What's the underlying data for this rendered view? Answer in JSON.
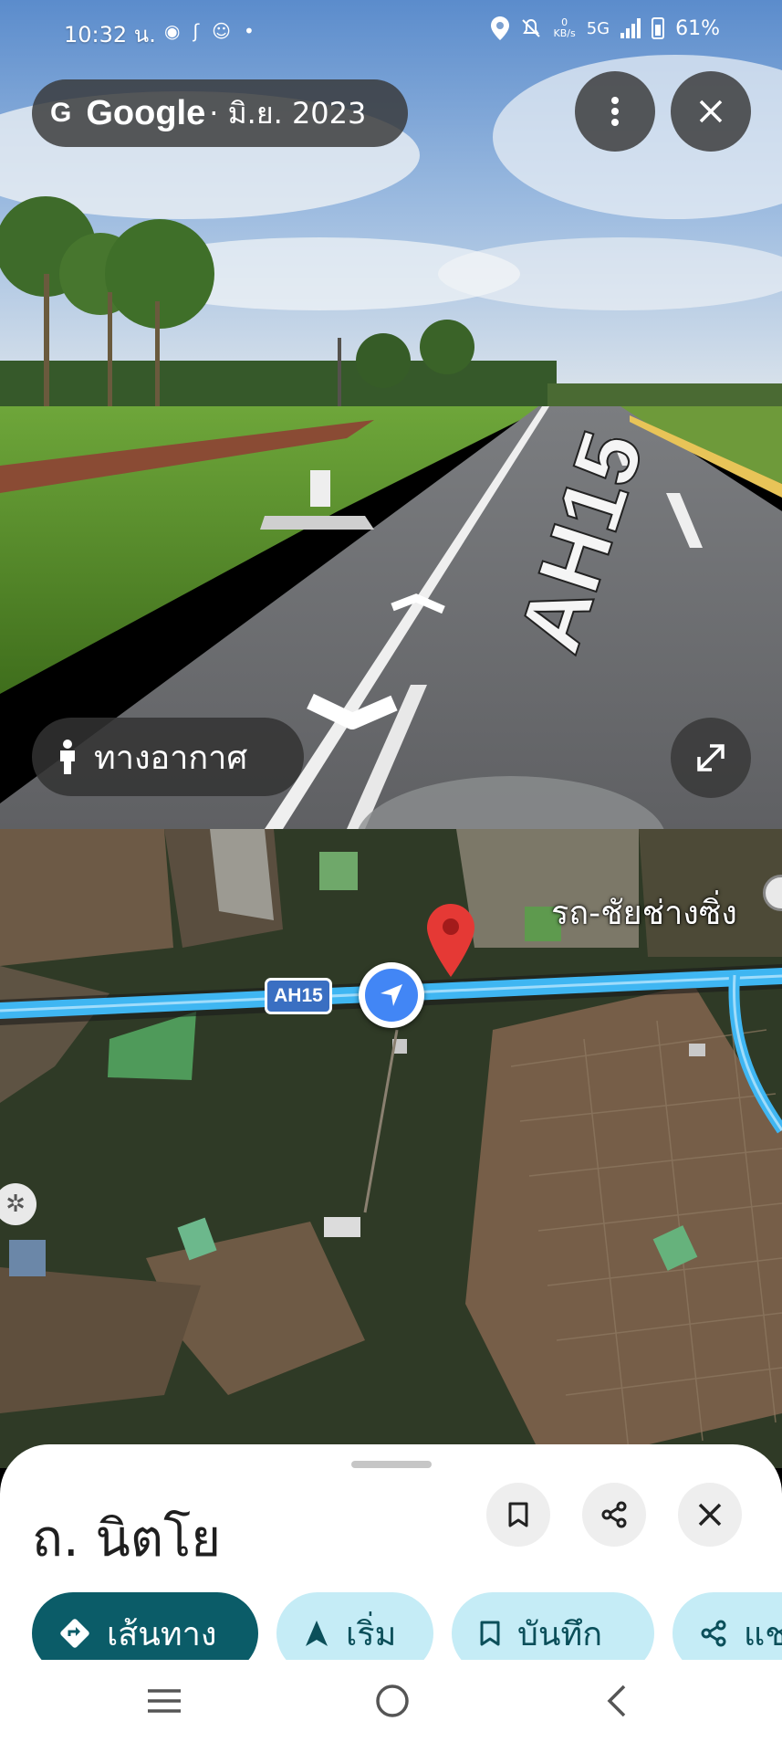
{
  "status_bar": {
    "time": "10:32 น.",
    "net_speed_value": "0",
    "net_speed_unit": "KB/s",
    "network": "5G",
    "battery": "61%",
    "icons": [
      "line-icon",
      "s-app-icon",
      "character-icon",
      "dot-icon",
      "location-icon",
      "mute-icon",
      "signal-icon",
      "battery-icon"
    ]
  },
  "street_view": {
    "brand": "Google",
    "date": "· มิ.ย. 2023",
    "aerial_label": "ทางอากาศ",
    "road_marking": "AH15"
  },
  "map": {
    "road_label": "AH15",
    "place_label": "รถ-ชัยช่างซิ่ง",
    "colors": {
      "route": "#3fb6f2",
      "pin": "#e53935",
      "nav": "#4286f5"
    }
  },
  "sheet": {
    "title": "ถ. นิตโย",
    "actions": [
      {
        "label": "เส้นทาง",
        "icon": "directions-icon"
      },
      {
        "label": "เริ่ม",
        "icon": "navigation-arrow-icon"
      },
      {
        "label": "บันทึก",
        "icon": "bookmark-icon"
      },
      {
        "label": "แช",
        "icon": "share-icon"
      }
    ]
  },
  "colors": {
    "primary_action": "#0b5c68",
    "secondary_action": "#c5ecf6"
  }
}
